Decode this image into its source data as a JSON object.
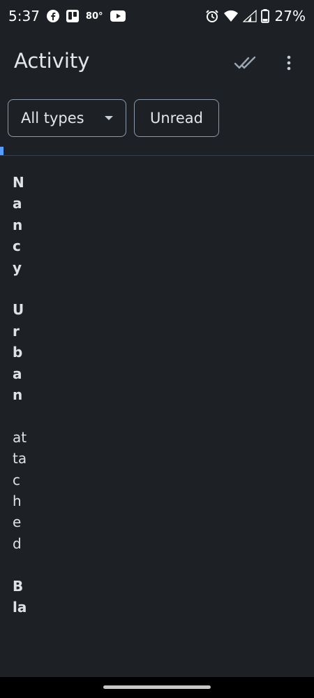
{
  "status_bar": {
    "time": "5:37",
    "temperature": "80°",
    "battery": "27%"
  },
  "header": {
    "title": "Activity"
  },
  "filters": {
    "types_label": "All types",
    "unread_label": "Unread"
  },
  "activity": {
    "actor_first": "Nancy",
    "actor_last": "Urban",
    "action": "attached",
    "object_fragment": "Bla"
  },
  "colors": {
    "background": "#1d2125",
    "accent": "#579dff",
    "chip_border": "#8c9bab"
  }
}
